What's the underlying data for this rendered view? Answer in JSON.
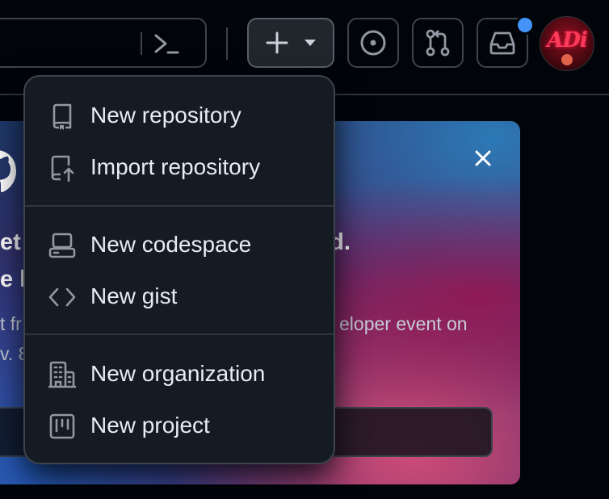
{
  "header": {
    "command_palette_icon": "terminal-icon",
    "create_icon": "plus-icon",
    "create_caret_icon": "triangle-down-icon",
    "issues_icon": "issue-opened-icon",
    "pull_requests_icon": "git-pull-request-icon",
    "inbox_icon": "inbox-icon",
    "notification_color": "#4493f8",
    "avatar_text": "ADi"
  },
  "banner": {
    "line1_left": "et",
    "line1_right": "ed.",
    "line2_left": "e l",
    "line3_left": "t fr",
    "line3_right": "eloper event on",
    "line4_left": "v. 8",
    "close_icon": "x-icon",
    "logo_icon": "github-mark-icon"
  },
  "menu": {
    "groups": [
      [
        {
          "label": "New repository",
          "icon": "repo-icon"
        },
        {
          "label": "Import repository",
          "icon": "repo-push-icon"
        }
      ],
      [
        {
          "label": "New codespace",
          "icon": "codespaces-icon"
        },
        {
          "label": "New gist",
          "icon": "code-icon"
        }
      ],
      [
        {
          "label": "New organization",
          "icon": "organization-icon"
        },
        {
          "label": "New project",
          "icon": "project-icon"
        }
      ]
    ]
  },
  "colors": {
    "page_bg": "#010409",
    "menu_bg": "#151b23",
    "border": "#3d444d",
    "text": "#e6edf3",
    "icon": "#9198a1"
  }
}
